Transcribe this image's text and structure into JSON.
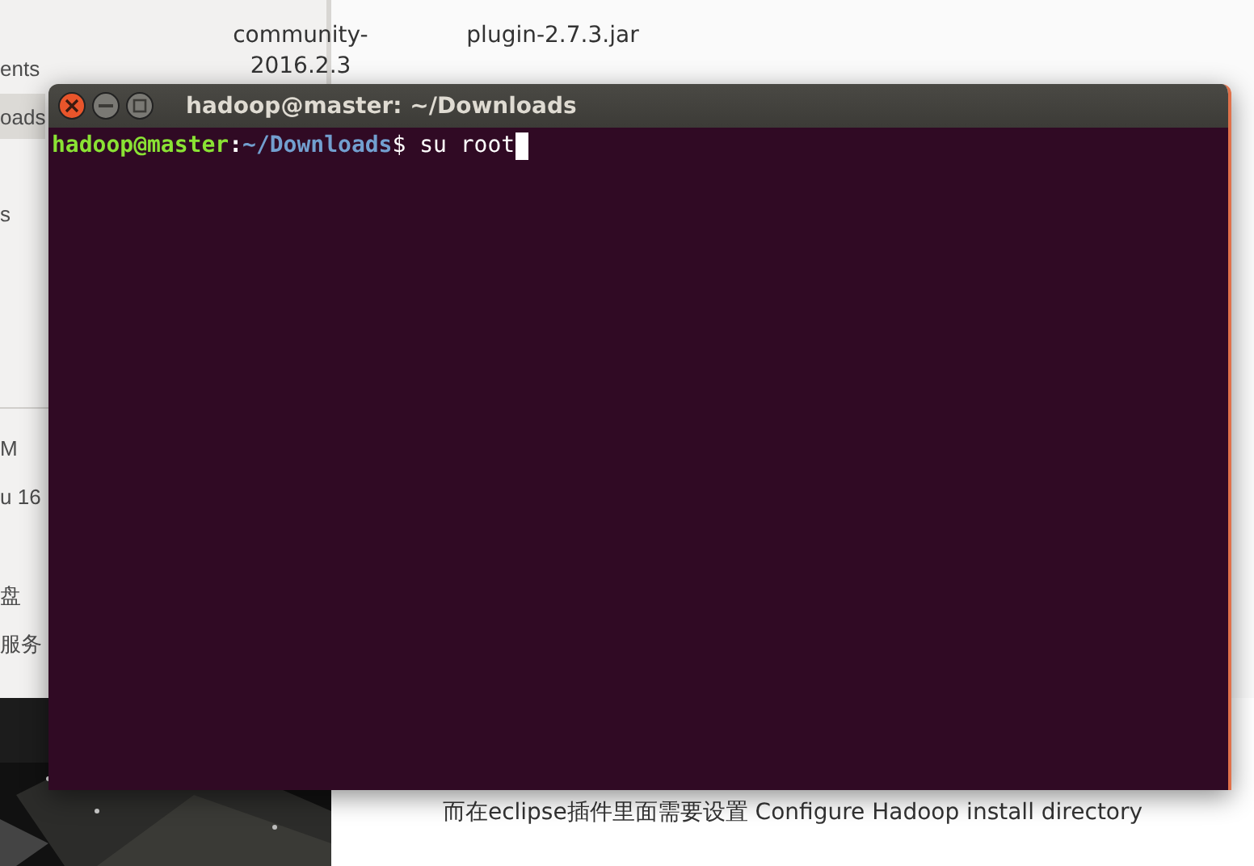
{
  "sidebar": {
    "items": [
      {
        "label": "ents",
        "selected": false
      },
      {
        "label": "oads",
        "selected": true
      },
      {
        "label": "s",
        "selected": false
      },
      {
        "label": "M",
        "selected": false
      },
      {
        "label": "u 16",
        "selected": false
      },
      {
        "label": "盘",
        "selected": false
      },
      {
        "label": "服务",
        "selected": false
      }
    ]
  },
  "files": [
    {
      "lines": [
        "community-",
        "2016.2.3"
      ]
    },
    {
      "lines": [
        "plugin-2.7.3.jar"
      ]
    }
  ],
  "caption": "而在eclipse插件里面需要设置 Configure Hadoop install directory",
  "terminal": {
    "title": "hadoop@master: ~/Downloads",
    "prompt_user": "hadoop@master",
    "prompt_sep": ":",
    "prompt_path": "~/Downloads",
    "prompt_end": "$ ",
    "command": "su root"
  }
}
